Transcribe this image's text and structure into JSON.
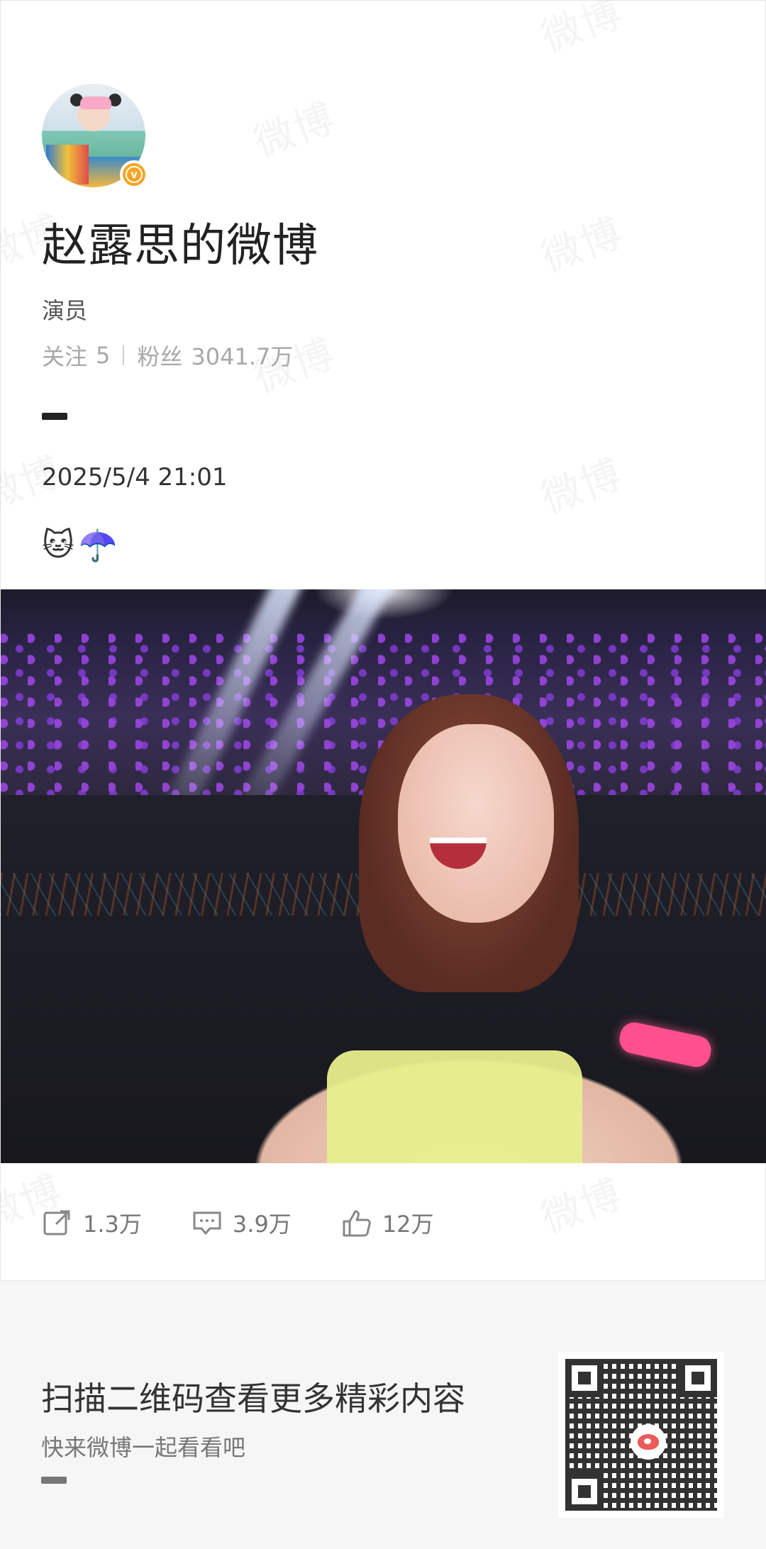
{
  "watermark": "微博",
  "profile": {
    "name": "赵露思的微博",
    "role": "演员",
    "following_label": "关注",
    "following_count": "5",
    "fans_label": "粉丝",
    "fans_count": "3041.7万"
  },
  "post": {
    "date": "2025/5/4 21:01",
    "emojis": [
      "🐱",
      "☂️"
    ]
  },
  "actions": {
    "repost": "1.3万",
    "comment": "3.9万",
    "like": "12万"
  },
  "footer": {
    "title": "扫描二维码查看更多精彩内容",
    "subtitle": "快来微博一起看看吧"
  },
  "colors": {
    "verified": "#f5a623",
    "accent_red": "#e83232"
  },
  "icons": {
    "repost": "repost-icon",
    "comment": "comment-icon",
    "like": "like-icon"
  }
}
